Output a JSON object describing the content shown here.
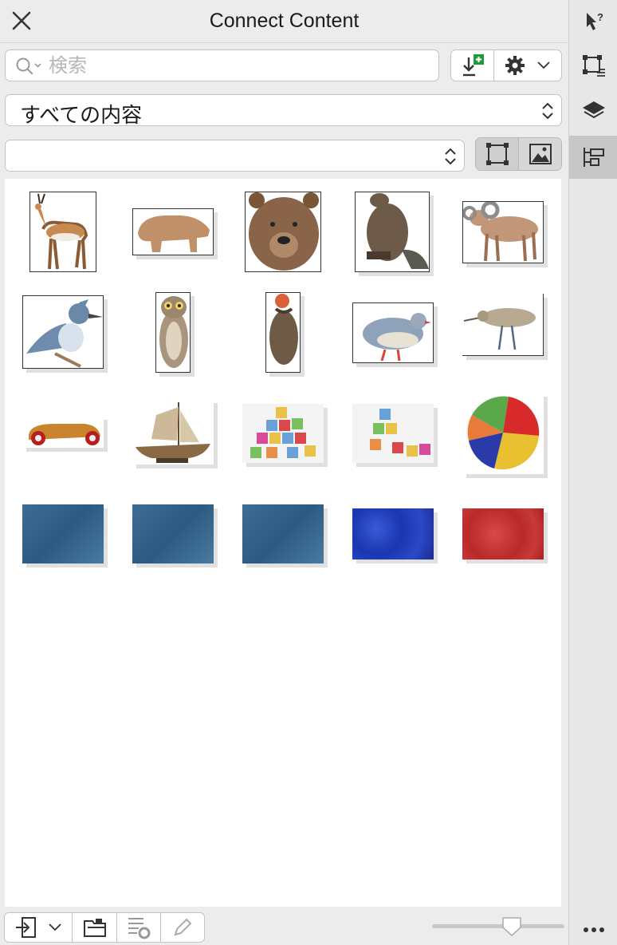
{
  "window": {
    "title": "Connect Content"
  },
  "search": {
    "placeholder": "検索",
    "value": ""
  },
  "folder_select": {
    "value": "すべての内容"
  },
  "filter_select": {
    "value": ""
  },
  "view_modes": {
    "selected": "frame"
  },
  "thumbnails": [
    {
      "name": "pronghorn",
      "kind": "image"
    },
    {
      "name": "brown bear",
      "kind": "image"
    },
    {
      "name": "bear head",
      "kind": "image"
    },
    {
      "name": "beaver",
      "kind": "image"
    },
    {
      "name": "bighorn sheep",
      "kind": "image"
    },
    {
      "name": "kingfisher",
      "kind": "image"
    },
    {
      "name": "owl",
      "kind": "image"
    },
    {
      "name": "vulture",
      "kind": "image"
    },
    {
      "name": "partridge",
      "kind": "image"
    },
    {
      "name": "rail bird",
      "kind": "image"
    },
    {
      "name": "toy race car",
      "kind": "image"
    },
    {
      "name": "model sailboat",
      "kind": "image"
    },
    {
      "name": "letter blocks",
      "kind": "image"
    },
    {
      "name": "toy blocks",
      "kind": "image"
    },
    {
      "name": "beach ball",
      "kind": "image"
    },
    {
      "name": "blue texture",
      "kind": "texture"
    },
    {
      "name": "blue texture",
      "kind": "texture"
    },
    {
      "name": "blue texture",
      "kind": "texture"
    },
    {
      "name": "cobalt texture",
      "kind": "texture"
    },
    {
      "name": "red texture",
      "kind": "texture"
    }
  ],
  "zoom": {
    "level": 0.6
  },
  "colors": {
    "import_plus": "#1f9a3c",
    "panel_bg": "#ececec",
    "content_bg": "#ffffff"
  }
}
